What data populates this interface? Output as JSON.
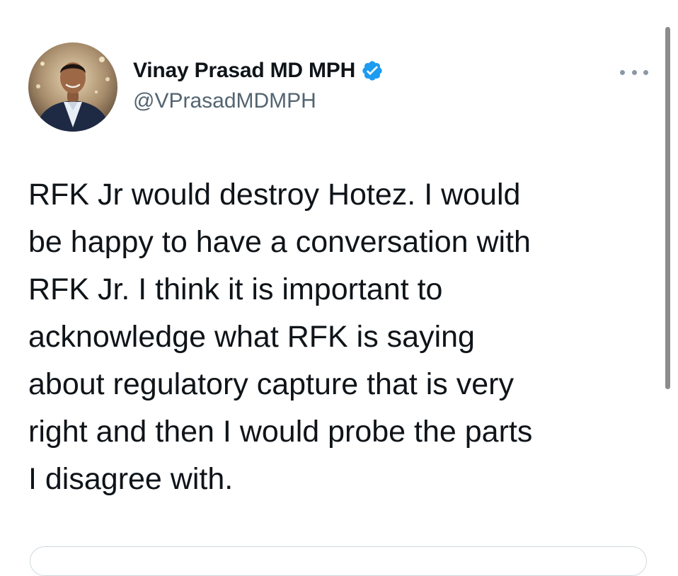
{
  "author": {
    "display_name": "Vinay Prasad MD MPH",
    "handle": "@VPrasadMDMPH",
    "verified": true,
    "avatar_icon": "profile-photo",
    "verified_icon": "verified-badge-icon",
    "verified_color": "#1d9bf0"
  },
  "more_icon": "more-options-icon",
  "tweet": {
    "lines": [
      "RFK Jr would destroy Hotez. I would",
      "be happy to have a conversation with",
      "RFK Jr. I think it is important to",
      "acknowledge what RFK is saying",
      "about regulatory capture that is very",
      "right and then I would probe the parts",
      "I disagree with."
    ]
  },
  "colors": {
    "text": "#0f1419",
    "secondary_text": "#536471",
    "background": "#ffffff"
  }
}
